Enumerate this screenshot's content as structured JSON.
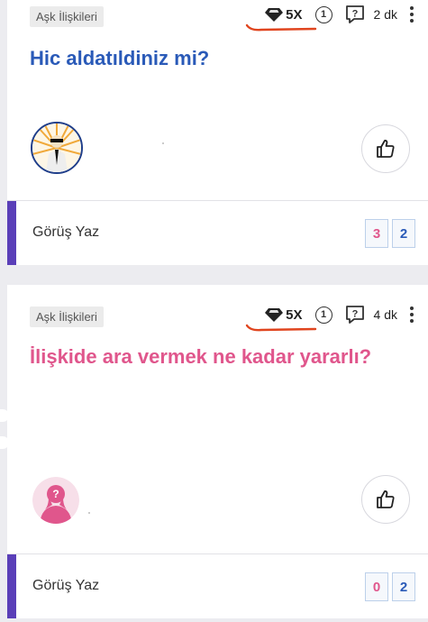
{
  "posts": [
    {
      "category": "Aşk İlişkileri",
      "multiplier": "5X",
      "circle_number": "1",
      "time": "2 dk",
      "title": "Hic aldatıldiniz mi?",
      "footer_label": "Görüş Yaz",
      "count_left": "3",
      "count_right": "2"
    },
    {
      "category": "Aşk İlişkileri",
      "multiplier": "5X",
      "circle_number": "1",
      "time": "4 dk",
      "title": "İlişkide ara vermek ne kadar yararlı?",
      "avatar_mark": "?",
      "footer_label": "Görüş Yaz",
      "count_left": "0",
      "count_right": "2"
    }
  ],
  "colors": {
    "accent_bar": "#5a3fb8",
    "title_blue": "#2a5ab8",
    "title_pink": "#e0568c",
    "annotation_red": "#e0451f"
  },
  "icons": [
    "diamond-icon",
    "circle-number-icon",
    "question-box-icon",
    "more-vert-icon",
    "thumbs-up-icon"
  ]
}
